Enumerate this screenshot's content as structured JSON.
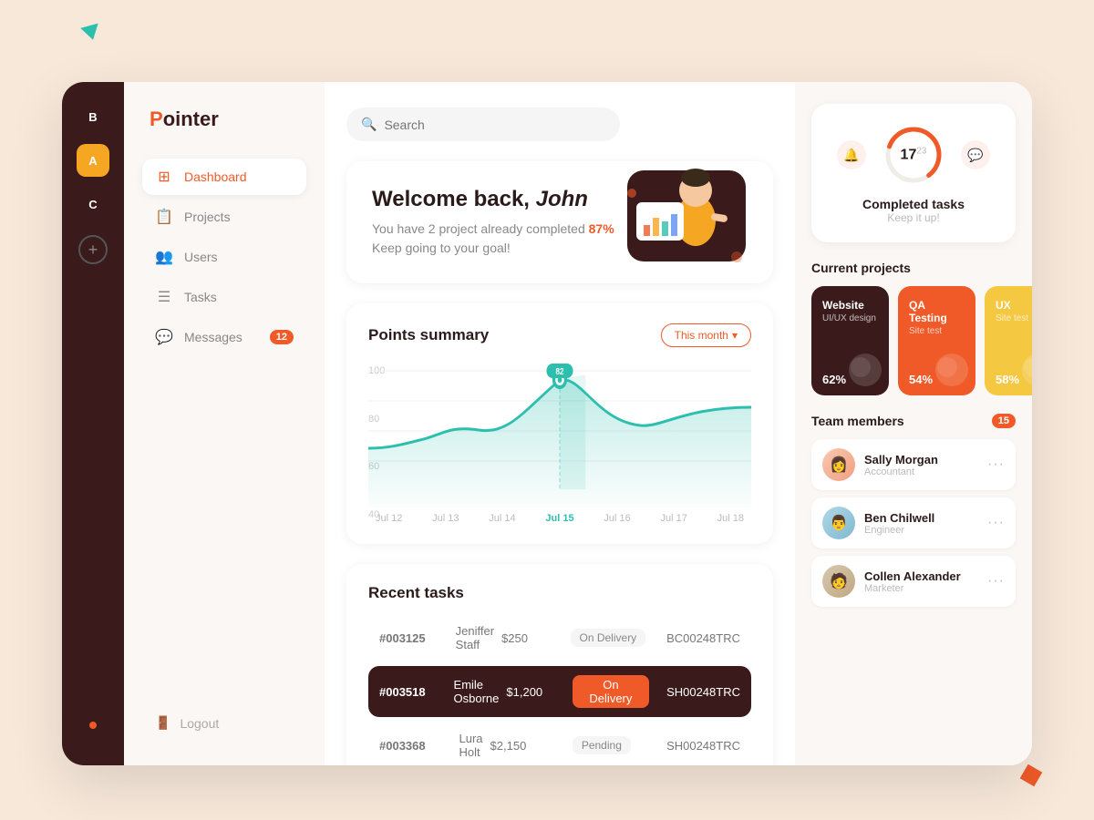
{
  "app": {
    "name": "Pointer",
    "logo_p": "P",
    "logo_rest": "ointer"
  },
  "decorative": {
    "triangle_color": "#2dbfad",
    "square_color": "#f05a28"
  },
  "sidebar_dark": {
    "items": [
      {
        "label": "B",
        "active": false
      },
      {
        "label": "A",
        "active": true
      },
      {
        "label": "C",
        "active": false
      }
    ],
    "add_label": "+"
  },
  "sidebar_nav": {
    "items": [
      {
        "label": "Dashboard",
        "icon": "⊞",
        "active": true,
        "badge": null
      },
      {
        "label": "Projects",
        "icon": "📋",
        "active": false,
        "badge": null
      },
      {
        "label": "Users",
        "icon": "👥",
        "active": false,
        "badge": null
      },
      {
        "label": "Tasks",
        "icon": "☰",
        "active": false,
        "badge": null
      },
      {
        "label": "Messages",
        "icon": "💬",
        "active": false,
        "badge": "12"
      }
    ],
    "logout_label": "Logout"
  },
  "search": {
    "placeholder": "Search"
  },
  "welcome": {
    "greeting": "Welcome back, ",
    "name": "John",
    "line1_prefix": "You have 2 project already completed ",
    "percent": "87%",
    "line2": "Keep going to your goal!"
  },
  "points_summary": {
    "title": "Points summary",
    "month_btn": "This month",
    "y_labels": [
      "100",
      "80",
      "60",
      "40"
    ],
    "x_labels": [
      "Jul 12",
      "Jul 13",
      "Jul 14",
      "Jul 15",
      "Jul 16",
      "Jul 17",
      "Jul 18"
    ],
    "active_x": "Jul 15",
    "peak_label": "82",
    "chart_color": "#2dbfad"
  },
  "recent_tasks": {
    "title": "Recent tasks",
    "rows": [
      {
        "id": "#003125",
        "name": "Jeniffer Staff",
        "amount": "$250",
        "status": "On Delivery",
        "code": "BC00248TRC",
        "highlighted": false
      },
      {
        "id": "#003518",
        "name": "Emile Osborne",
        "amount": "$1,200",
        "status": "On Delivery",
        "code": "SH00248TRC",
        "highlighted": true
      },
      {
        "id": "#003368",
        "name": "Lura Holt",
        "amount": "$2,150",
        "status": "Pending",
        "code": "SH00248TRC",
        "highlighted": false
      }
    ]
  },
  "completed_tasks": {
    "count": "17",
    "total": "23",
    "label": "Completed tasks",
    "sublabel": "Keep it up!",
    "arc_color": "#f05a28",
    "arc_bg": "#f0ece8"
  },
  "current_projects": {
    "title": "Current projects",
    "projects": [
      {
        "title": "Website",
        "sub": "UI/UX design",
        "percent": "62%",
        "color": "brown"
      },
      {
        "title": "QA Testing",
        "sub": "Site test",
        "percent": "54%",
        "color": "red"
      },
      {
        "title": "UX",
        "sub": "Site test",
        "percent": "58%",
        "color": "yellow"
      }
    ]
  },
  "team_members": {
    "title": "Team members",
    "badge": "15",
    "members": [
      {
        "name": "Sally Morgan",
        "role": "Accountant",
        "avatar_class": "avatar-sally",
        "emoji": "👩"
      },
      {
        "name": "Ben Chilwell",
        "role": "Engineer",
        "avatar_class": "avatar-ben",
        "emoji": "👨"
      },
      {
        "name": "Collen Alexander",
        "role": "Marketer",
        "avatar_class": "avatar-collen",
        "emoji": "🧑"
      }
    ]
  }
}
